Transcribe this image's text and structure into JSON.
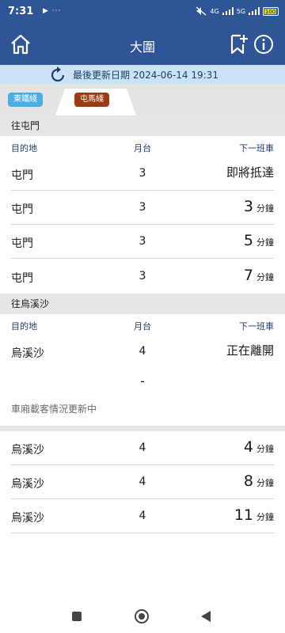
{
  "status_bar": {
    "time": "7:31",
    "left_icons": "▶ ···",
    "network_1": "4G",
    "network_2": "5G",
    "battery": "100"
  },
  "header": {
    "title": "大圍",
    "home_icon": "home-icon",
    "bookmark_icon": "bookmark-add-icon",
    "info_icon": "info-icon"
  },
  "update": {
    "icon": "refresh-icon",
    "text": "最後更新日期 2024-06-14 19:31"
  },
  "tabs": [
    {
      "label": "東鐵綫",
      "color": "#4aaee3",
      "active": false
    },
    {
      "label": "屯馬綫",
      "color": "#9a3b12",
      "active": true
    }
  ],
  "columns": {
    "destination": "目的地",
    "platform": "月台",
    "next_train": "下一班車"
  },
  "sections": [
    {
      "title": "往屯門",
      "rows": [
        {
          "destination": "屯門",
          "platform": "3",
          "eta_text": "即將抵達"
        },
        {
          "destination": "屯門",
          "platform": "3",
          "eta_num": "3",
          "eta_unit": "分鐘"
        },
        {
          "destination": "屯門",
          "platform": "3",
          "eta_num": "5",
          "eta_unit": "分鐘"
        },
        {
          "destination": "屯門",
          "platform": "3",
          "eta_num": "7",
          "eta_unit": "分鐘"
        }
      ]
    },
    {
      "title": "往烏溪沙",
      "rows": [
        {
          "destination": "烏溪沙",
          "platform": "4",
          "eta_text": "正在離開"
        },
        {
          "destination": "烏溪沙",
          "platform": "4",
          "eta_num": "4",
          "eta_unit": "分鐘"
        },
        {
          "destination": "烏溪沙",
          "platform": "4",
          "eta_num": "8",
          "eta_unit": "分鐘"
        },
        {
          "destination": "烏溪沙",
          "platform": "4",
          "eta_num": "11",
          "eta_unit": "分鐘"
        }
      ],
      "dash": "-",
      "occupancy_note": "車廂載客情況更新中"
    }
  ],
  "colors": {
    "header": "#2f5597",
    "update_bar": "#c9e3f5",
    "section_bg": "#e6e6e6",
    "column_header": "#1f3c6e"
  }
}
